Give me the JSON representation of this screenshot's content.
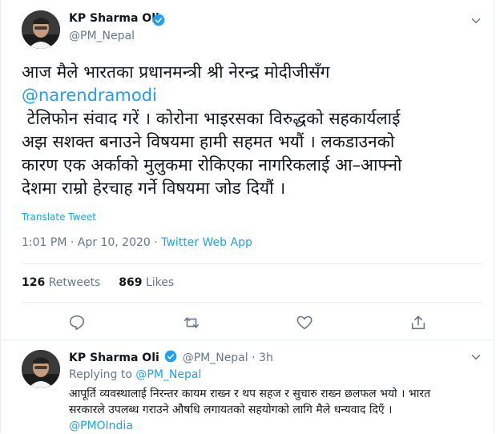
{
  "tweet": {
    "author_name": "KP Sharma Oli",
    "author_handle": "@PM_Nepal",
    "text_lines": [
      "आज मैले भारतका प्रधानमन्त्री श्री नेरन्द्र मोदीजीसँग",
      " टेलिफोन संवाद गरें । कोरोना भाइरसका विरुद्धको सहकार्यलाई",
      "अझ सशक्त बनाउने विषयमा हामी सहमत भयौं । लकडाउनको",
      "कारण एक अर्काको मुलुकमा रोकिएका नागरिकलाई आ–आफ्नो",
      "देशमा राम्रो हेरचाह गर्ने विषयमा जोड दियौं ।"
    ],
    "mention": "@narendramodi",
    "translate_label": "Translate Tweet",
    "time": "1:01 PM",
    "date": "Apr 10, 2020",
    "separator": "·",
    "app": "Twitter Web App",
    "retweets_count": "126",
    "retweets_label": "Retweets",
    "likes_count": "869",
    "likes_label": "Likes",
    "actions": [
      "reply-icon",
      "retweet-icon",
      "like-icon",
      "share-icon"
    ]
  },
  "reply": {
    "author_name": "KP Sharma Oli",
    "author_handle": "@PM_Nepal",
    "age": "3h",
    "replying_prefix": "Replying to",
    "replying_to": "@PM_Nepal",
    "text_lines": [
      "आपूर्ति व्यवस्थालाई निरन्तर कायम राख्न र थप सहज र सुचारु राख्न छलफल भयो । भारत",
      "सरकारले उपलब्ध गराउने औषधि लगायतको सहयोगको लागि मैले धन्यवाद दिएँ ।"
    ],
    "mention": "@PMOIndia"
  },
  "colors": {
    "accent": "#1da1f2",
    "text": "#14171a",
    "muted": "#657786",
    "divider": "#e6ecf0"
  }
}
